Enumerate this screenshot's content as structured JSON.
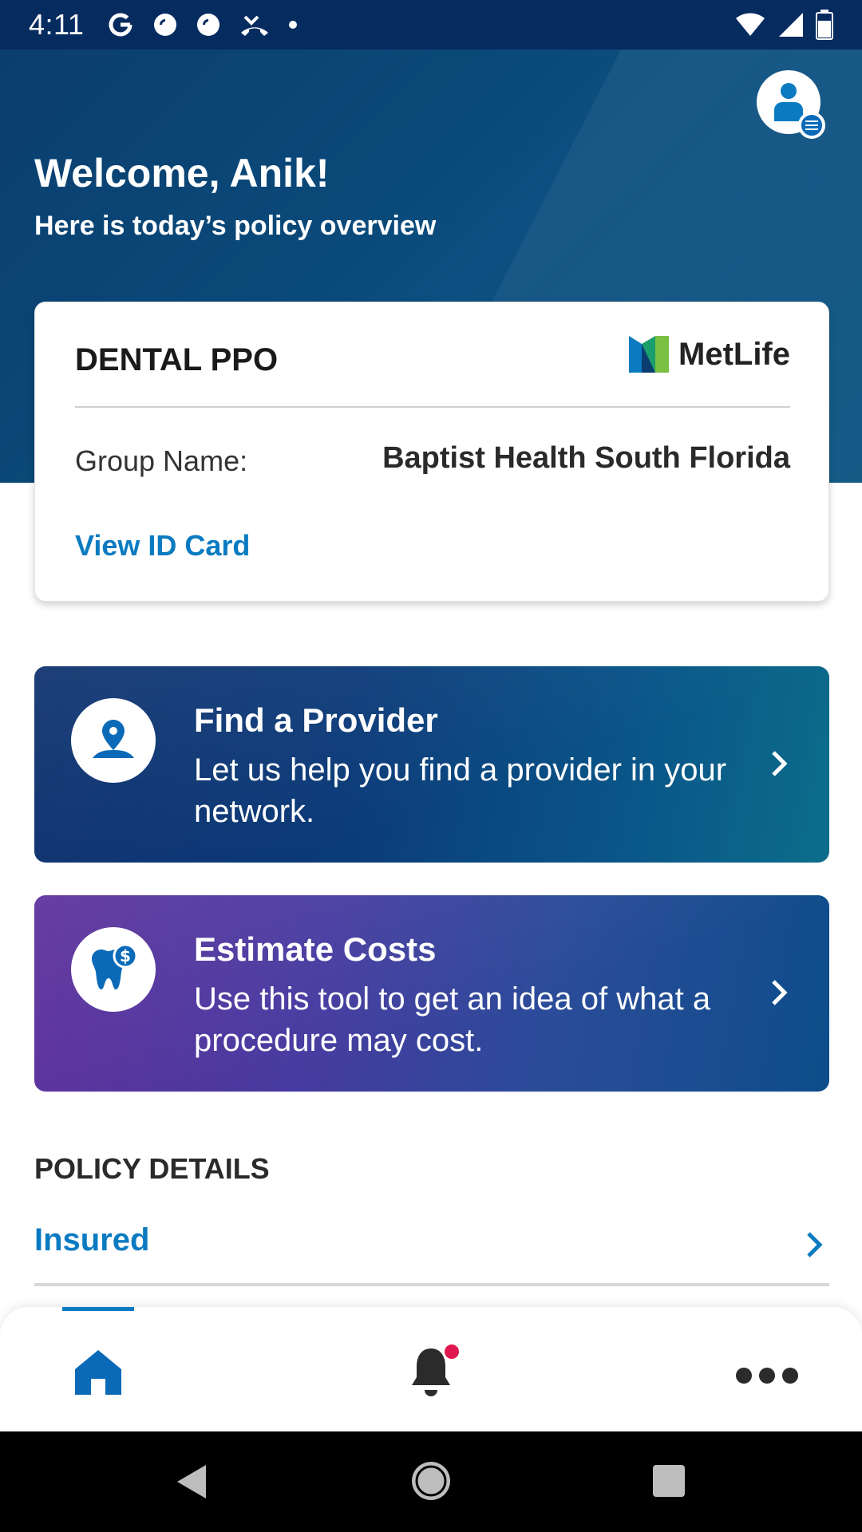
{
  "status_bar": {
    "time": "4:11",
    "left_icons": [
      "google-icon",
      "pocket-casts-icon",
      "pocket-casts-icon",
      "phone-missed-icon",
      "dot-icon"
    ],
    "right_icons": [
      "wifi-icon",
      "signal-icon",
      "battery-icon"
    ]
  },
  "header": {
    "welcome": "Welcome, Anik!",
    "subtitle": "Here is today’s policy overview",
    "avatar_icon": "profile-menu-icon"
  },
  "policy_card": {
    "plan_name": "DENTAL PPO",
    "logo_text": "MetLife",
    "group_label": "Group Name:",
    "group_value": "Baptist Health South Florida",
    "id_card_link": "View ID Card"
  },
  "tiles": [
    {
      "title": "Find a Provider",
      "description": "Let us help you find a provider in your network.",
      "icon": "location-pin-icon"
    },
    {
      "title": "Estimate Costs",
      "description": "Use this tool to get an idea of what a procedure may cost.",
      "icon": "tooth-dollar-icon"
    }
  ],
  "policy_details": {
    "section_label": "POLICY DETAILS",
    "items": [
      {
        "label": "Insured"
      }
    ]
  },
  "bottom_nav": {
    "items": [
      "home-icon",
      "notifications-icon",
      "more-icon"
    ],
    "active": "home-icon",
    "notification_badge": true
  },
  "colors": {
    "header_bg": "#0b3d6e",
    "link_blue": "#0a7bc1",
    "badge_red": "#e0184f"
  }
}
